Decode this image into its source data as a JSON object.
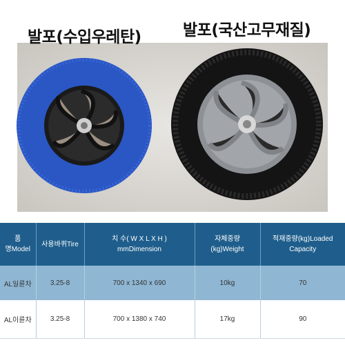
{
  "labels": {
    "left": "발포(수입우레탄)",
    "right": "발포(국산고무재질)"
  },
  "wheels": [
    {
      "tire_color": "#2a57c4",
      "hub_color": "#1a1a1a"
    },
    {
      "tire_color": "#141414",
      "hub_color": "#8d9196"
    }
  ],
  "table": {
    "headers": [
      {
        "line1": "품",
        "line2": "명Model"
      },
      {
        "line1": "사용바퀴Tire",
        "line2": ""
      },
      {
        "line1": "치 수( W X L X H )",
        "line2": "mmDimension"
      },
      {
        "line1": "자체중량",
        "line2": "(kg)Weight"
      },
      {
        "line1": "적재중량(kg)Loaded",
        "line2": "Capacity"
      }
    ],
    "rows": [
      [
        "AL일륜차",
        "3.25-8",
        "700 x 1340 x 690",
        "10kg",
        "70"
      ],
      [
        "AL이륜차",
        "3.25-8",
        "700 x 1380 x 740",
        "17kg",
        "90"
      ]
    ]
  }
}
